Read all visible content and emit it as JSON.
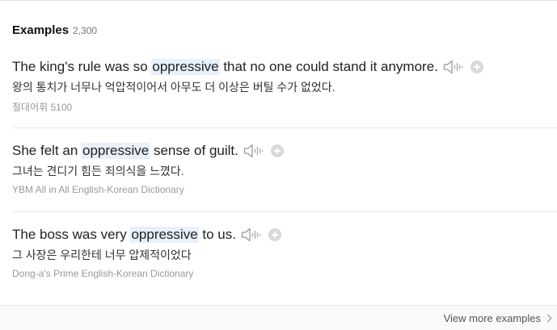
{
  "section": {
    "title": "Examples",
    "count": "2,300"
  },
  "examples": [
    {
      "before": "The king's rule was so ",
      "highlight": "oppressive",
      "after": " that no one could stand it anymore.",
      "translation": "왕의 통치가 너무나 억압적이어서 아무도 더 이상은 버틸 수가 없었다.",
      "source": "절대어휘 5100"
    },
    {
      "before": "She felt an ",
      "highlight": "oppressive",
      "after": " sense of guilt.",
      "translation": "그녀는 견디기 힘든 죄의식을 느꼈다.",
      "source": "YBM All in All English-Korean Dictionary"
    },
    {
      "before": "The boss was very ",
      "highlight": "oppressive",
      "after": " to us.",
      "translation": "그 사장은 우리한테 너무 압제적이었다",
      "source": "Dong-a's Prime English-Korean Dictionary"
    }
  ],
  "footer": {
    "more_label": "View more examples"
  },
  "colors": {
    "highlight_bg": "#e7f0fb",
    "source_text": "#999999",
    "icon_gray": "#bbbbbb"
  },
  "icons": {
    "audio": "speaker-icon",
    "add": "plus-circle-icon",
    "more": "chevron-right-icon"
  }
}
